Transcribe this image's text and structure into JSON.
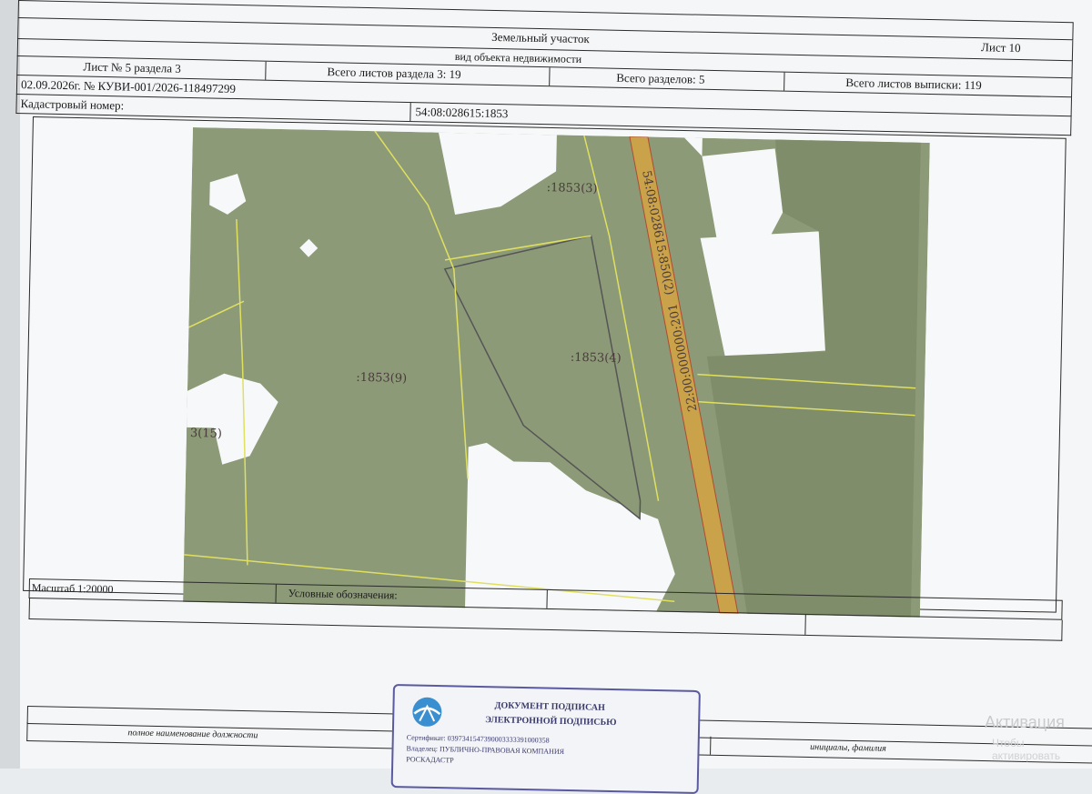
{
  "header": {
    "object_type": "Земельный участок",
    "sheet_label": "Лист 10",
    "object_kind": "вид объекта недвижимости",
    "section_sheet": "Лист № 5 раздела 3",
    "section_total": "Всего листов раздела 3: 19",
    "sections_total": "Всего разделов: 5",
    "extract_total": "Всего листов выписки: 119",
    "date_number": "02.09.2026г. № КУВИ-001/2026-118497299",
    "cadastral_label": "Кадастровый номер:",
    "cadastral_value": "54:08:028615:1853"
  },
  "map": {
    "labels": {
      "part3": ":1853(3)",
      "part4": ":1853(4)",
      "part9": ":1853(9)",
      "part15": "3(15)",
      "road_top": "54:08:028615:850(2)",
      "road_bottom": "22:00:000000:201"
    },
    "colors": {
      "land": "#8c9a78",
      "land_dark": "#7f8d6b",
      "boundary": "#e0e060",
      "road": "#c9a24a",
      "blank": "#f7f8f9"
    }
  },
  "footer": {
    "scale": "Масштаб 1:20000",
    "legend": "Условные обозначения:"
  },
  "signature": {
    "position_label": "полное наименование должности",
    "initials_label": "инициалы, фамилия",
    "stamp_title_1": "ДОКУМЕНТ ПОДПИСАН",
    "stamp_title_2": "ЭЛЕКТРОННОЙ ПОДПИСЬЮ",
    "stamp_cert": "Сертификат: 0397341547390003333391000358",
    "stamp_owner": "Владелец: ПУБЛИЧНО-ПРАВОВАЯ КОМПАНИЯ",
    "stamp_owner2": "РОСКАДАСТР"
  },
  "os_watermark": {
    "line1": "Активация",
    "line2": "Чтобы активировать"
  }
}
